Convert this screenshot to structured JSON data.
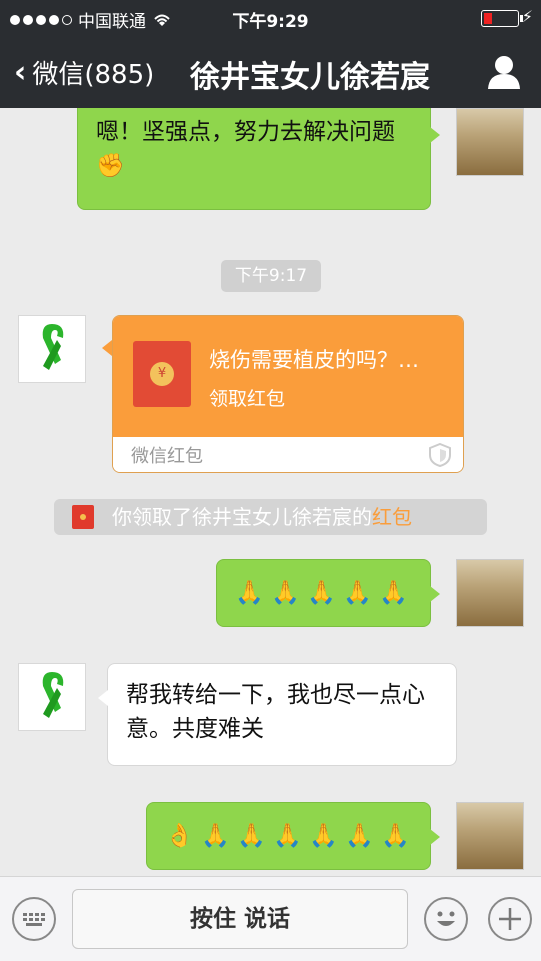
{
  "status_bar": {
    "carrier": "中国联通",
    "time": "下午9:29"
  },
  "nav": {
    "back_label": "微信(885)",
    "title": "徐井宝女儿徐若宸"
  },
  "messages": {
    "m1_text": "嗯！坚强点，努力去解决问题",
    "timestamp": "下午9:17",
    "red_packet": {
      "message": "烧伤需要植皮的吗？…",
      "claim_label": "领取红包",
      "brand": "微信红包"
    },
    "system_note": {
      "prefix": "你领取了徐井宝女儿徐若宸的",
      "link": "红包"
    },
    "m4_text": "帮我转给一下，我也尽一点心意。共度难关"
  },
  "input_bar": {
    "talk_label": "按住 说话"
  },
  "colors": {
    "nav_bg": "#2a2d31",
    "bubble_green": "#8fd64c",
    "red_packet_orange": "#fa9d3b",
    "chat_bg": "#ebebeb"
  },
  "icons": {
    "back": "chevron-left-icon",
    "contact": "person-icon",
    "keyboard": "keyboard-icon",
    "emoji": "smiley-icon",
    "plus": "plus-icon",
    "pray": "folded-hands-emoji",
    "ok": "ok-hand-emoji",
    "fist": "raised-fist-emoji"
  }
}
